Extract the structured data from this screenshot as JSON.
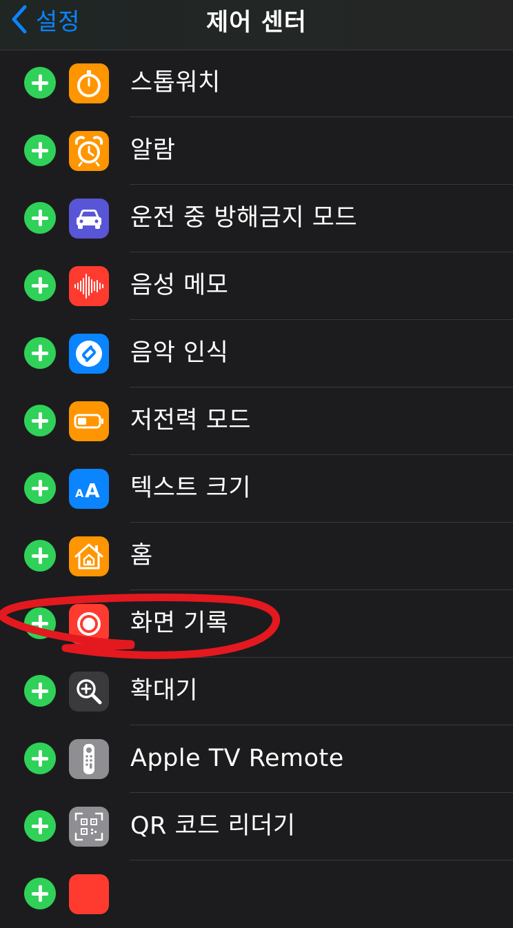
{
  "nav": {
    "back_label": "설정",
    "title": "제어 센터"
  },
  "controls": [
    {
      "label": "스톱워치",
      "icon": "stopwatch-icon",
      "color": "#ff9500"
    },
    {
      "label": "알람",
      "icon": "alarm-clock-icon",
      "color": "#ff9500"
    },
    {
      "label": "운전 중 방해금지 모드",
      "icon": "car-icon",
      "color": "#5856d6"
    },
    {
      "label": "음성 메모",
      "icon": "waveform-icon",
      "color": "#ff3b30"
    },
    {
      "label": "음악 인식",
      "icon": "shazam-icon",
      "color": "#0a84ff"
    },
    {
      "label": "저전력 모드",
      "icon": "battery-icon",
      "color": "#ff9500"
    },
    {
      "label": "텍스트 크기",
      "icon": "text-size-icon",
      "color": "#0a84ff"
    },
    {
      "label": "홈",
      "icon": "home-icon",
      "color": "#ff9500"
    },
    {
      "label": "화면 기록",
      "icon": "screen-record-icon",
      "color": "#ff3b30"
    },
    {
      "label": "확대기",
      "icon": "magnifier-icon",
      "color": "#3a3a3c"
    },
    {
      "label": "Apple TV Remote",
      "icon": "tv-remote-icon",
      "color": "#8e8e93"
    },
    {
      "label": "QR 코드 리더기",
      "icon": "qr-code-icon",
      "color": "#8e8e93"
    }
  ],
  "colors": {
    "add_button": "#30d158",
    "tint": "#0a84ff",
    "annotation": "#e3191f"
  }
}
